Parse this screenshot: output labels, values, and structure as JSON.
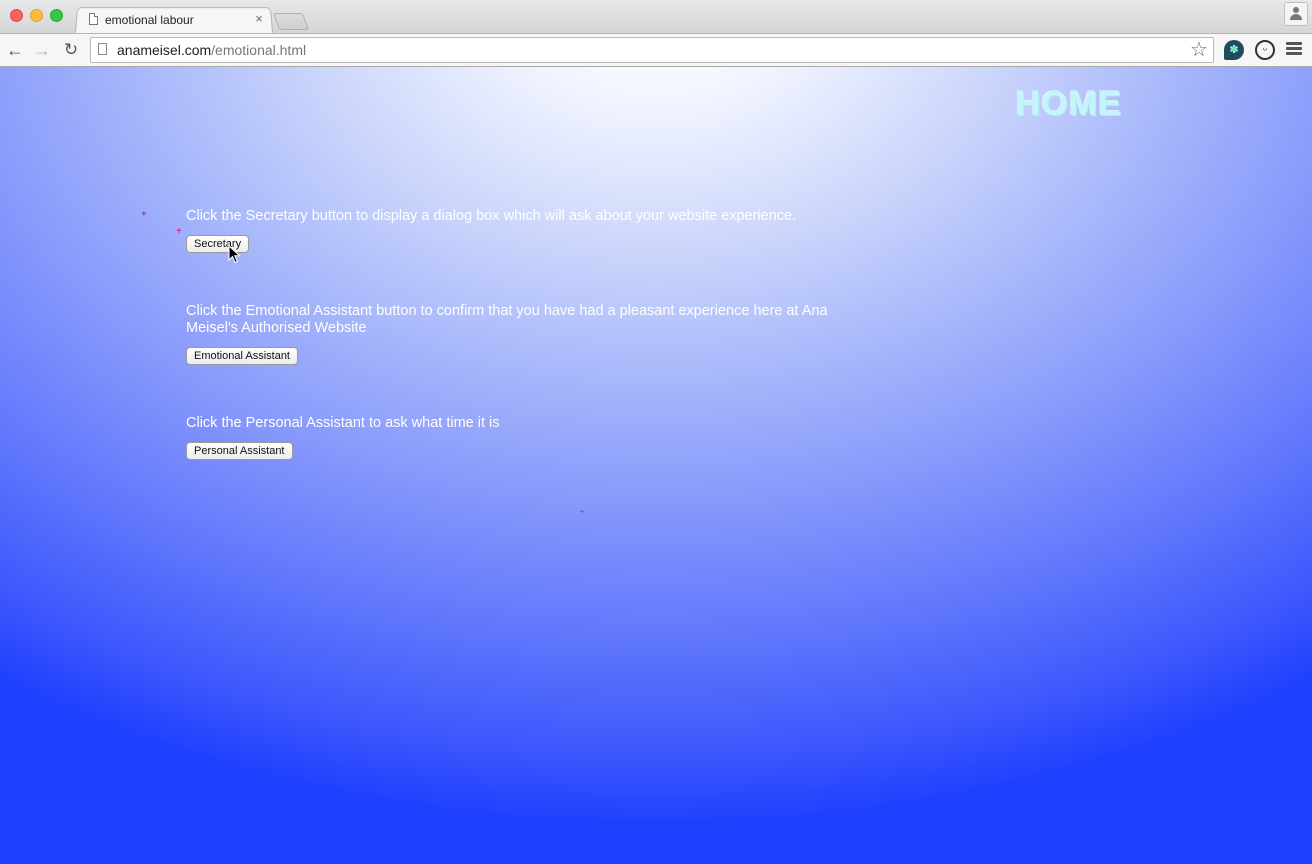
{
  "browser": {
    "tab_title": "emotional labour",
    "tab_close": "×",
    "url_host": "anameisel.com",
    "url_path": "/emotional.html",
    "back_glyph": "←",
    "forward_glyph": "→",
    "reload_glyph": "↻",
    "star_glyph": "☆",
    "icons": [
      "document-icon",
      "star-icon",
      "extension-icon",
      "smiley-icon",
      "menu-icon",
      "profile-icon"
    ]
  },
  "page": {
    "home_label": "HOME",
    "sections": [
      {
        "prompt": "Click the Secretary button to display a dialog box which will ask about your website experience.",
        "button_label": "Secretary"
      },
      {
        "prompt": "Click the Emotional Assistant button to confirm that you have had a pleasant experience here at Ana Meisel's Authorised Website",
        "button_label": "Emotional Assistant"
      },
      {
        "prompt": "Click the Personal Assistant to ask what time it is",
        "button_label": "Personal Assistant"
      }
    ]
  },
  "colors": {
    "background_top": "#ffffff",
    "background_bottom": "#1f41ff",
    "home_text": "#c6f4fb",
    "prompt_text": "#ffffff",
    "marker": "#e0008a"
  }
}
